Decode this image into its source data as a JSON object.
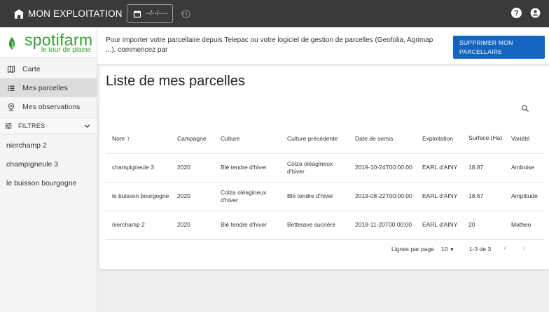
{
  "header": {
    "title": "MON EXPLOITATION",
    "date_value": "--/--/----"
  },
  "sidebar": {
    "logo_name": "spotifarm",
    "logo_sub": "le tour de plaine",
    "nav": [
      {
        "label": "Carte"
      },
      {
        "label": "Mes parcelles"
      },
      {
        "label": "Mes observations"
      }
    ],
    "filters_label": "FILTRES",
    "parcels": [
      "nierchamp 2",
      "champigneule 3",
      "le buisson bourgogne"
    ]
  },
  "info": {
    "text": "Pour importer votre parcellaire depuis Telepac ou votre logiciel de gestion de parcelles (Geofolia, Agrimap ...), commencez par",
    "delete_button": "SUPPRIMER MON PARCELLAIRE"
  },
  "main": {
    "title": "Liste de mes parcelles",
    "columns": [
      "Nom",
      "Campagne",
      "Culture",
      "Culture précédente",
      "Date de semis",
      "Exploitation",
      "Surface (Ha)",
      "Variété"
    ],
    "rows": [
      [
        "champigneule 3",
        "2020",
        "Blé tendre d'hiver",
        "Colza oléagineux d'hiver",
        "2019-10-24T00:00:00",
        "EARL d'AINY",
        "18.87",
        "Amboise"
      ],
      [
        "le buisson bourgogne",
        "2020",
        "Colza oléagineux d'hiver",
        "Blé tendre d'hiver",
        "2019-08-22T00:00:00",
        "EARL d'AINY",
        "18.67",
        "Amplitude"
      ],
      [
        "nierchamp 2",
        "2020",
        "Blé tendre d'hiver",
        "Betterave sucrière",
        "2019-11-20T00:00:00",
        "EARL d'AINY",
        "20",
        "Matheo"
      ]
    ],
    "pagination": {
      "rows_label": "Lignes par page",
      "rows_value": "10",
      "range": "1-3 de 3"
    }
  },
  "colors": {
    "topbar": "#3a3a3a",
    "brand_green": "#3a9b35",
    "button_blue": "#1565c0"
  },
  "icons": [
    "barn-icon",
    "calendar-icon",
    "history-icon",
    "help-icon",
    "account-icon",
    "map-icon",
    "list-icon",
    "pin-icon",
    "filter-icon",
    "search-icon"
  ]
}
